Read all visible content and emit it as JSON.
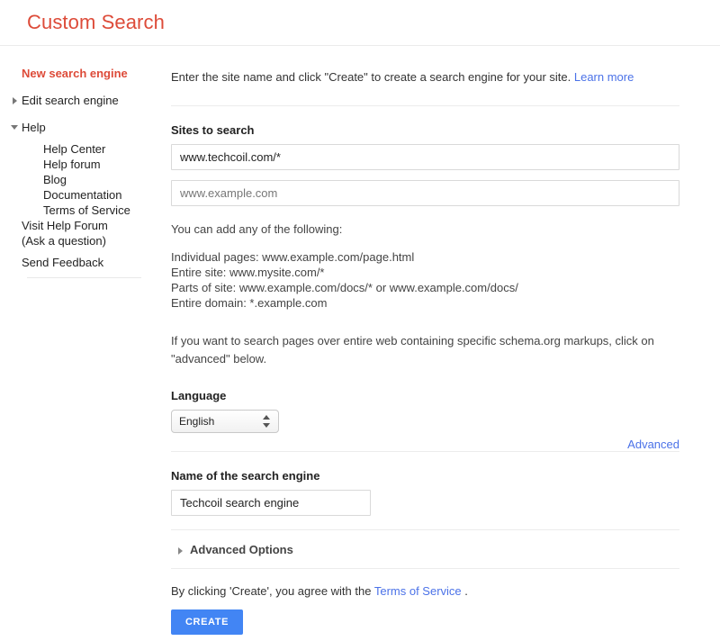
{
  "header": {
    "title": "Custom Search",
    "title_color": "#dd4b39"
  },
  "sidebar": {
    "new_search_engine": "New search engine",
    "edit_search_engine": "Edit search engine",
    "help": "Help",
    "help_children": [
      "Help Center",
      "Help forum",
      "Blog",
      "Documentation",
      "Terms of Service"
    ],
    "visit_help_forum_line1": "Visit Help Forum",
    "visit_help_forum_line2": "(Ask a question)",
    "send_feedback": "Send Feedback"
  },
  "main": {
    "intro_text": "Enter the site name and click \"Create\" to create a search engine for your site.",
    "intro_link": "Learn more",
    "sites_label": "Sites to search",
    "site_input_value": "www.techcoil.com/*",
    "site_input_placeholder": "www.example.com",
    "helper_lead": "You can add any of the following:",
    "helper_lines": [
      "Individual pages: www.example.com/page.html",
      "Entire site: www.mysite.com/*",
      "Parts of site: www.example.com/docs/* or www.example.com/docs/",
      "Entire domain: *.example.com"
    ],
    "helper_note": "If you want to search pages over entire web containing specific schema.org markups, click on \"advanced\" below.",
    "language_label": "Language",
    "language_selected": "English",
    "language_options": [
      "English"
    ],
    "advanced_link": "Advanced",
    "name_label": "Name of the search engine",
    "name_input_value": "Techcoil search engine",
    "advanced_options_label": "Advanced Options",
    "agree_prefix": "By clicking 'Create', you agree with the ",
    "agree_link": "Terms of Service",
    "agree_suffix": " .",
    "create_button": "CREATE"
  },
  "colors": {
    "accent_red": "#dd4b39",
    "link_blue": "#4b72e8",
    "button_blue": "#4285f4",
    "divider": "#ececec"
  }
}
